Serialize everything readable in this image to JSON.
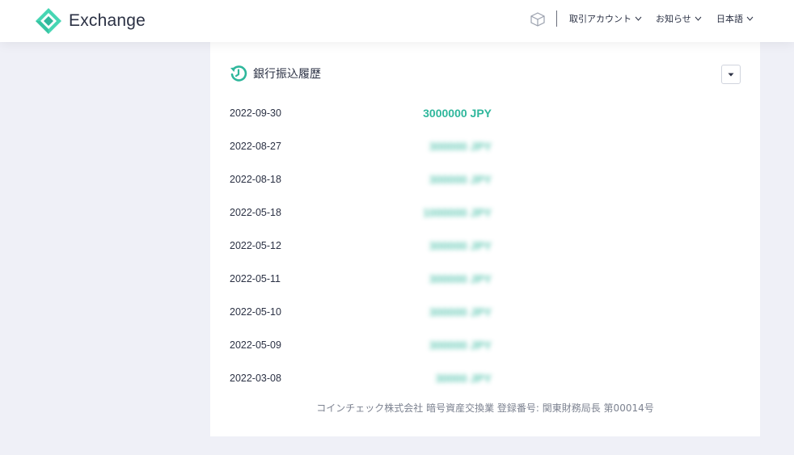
{
  "header": {
    "logo_text": "Exchange",
    "nav": {
      "trading_account": "取引アカウント",
      "notices": "お知らせ",
      "language": "日本語"
    }
  },
  "history": {
    "title": "銀行振込履歴",
    "rows": [
      {
        "date": "2022-09-30",
        "amount": "3000000 JPY"
      },
      {
        "date": "2022-08-27",
        "amount": "300000 JPY"
      },
      {
        "date": "2022-08-18",
        "amount": "300000 JPY"
      },
      {
        "date": "2022-05-18",
        "amount": "1000000 JPY"
      },
      {
        "date": "2022-05-12",
        "amount": "300000 JPY"
      },
      {
        "date": "2022-05-11",
        "amount": "300000 JPY"
      },
      {
        "date": "2022-05-10",
        "amount": "300000 JPY"
      },
      {
        "date": "2022-05-09",
        "amount": "300000 JPY"
      },
      {
        "date": "2022-03-08",
        "amount": "30000 JPY"
      }
    ]
  },
  "footer": {
    "company_note": "コインチェック株式会社 暗号資産交換業 登録番号: 関東財務局長 第00014号"
  },
  "colors": {
    "accent": "#2fb79c",
    "logo": "#3fd3b0",
    "text": "#2b3144",
    "background": "#eff0f7"
  }
}
